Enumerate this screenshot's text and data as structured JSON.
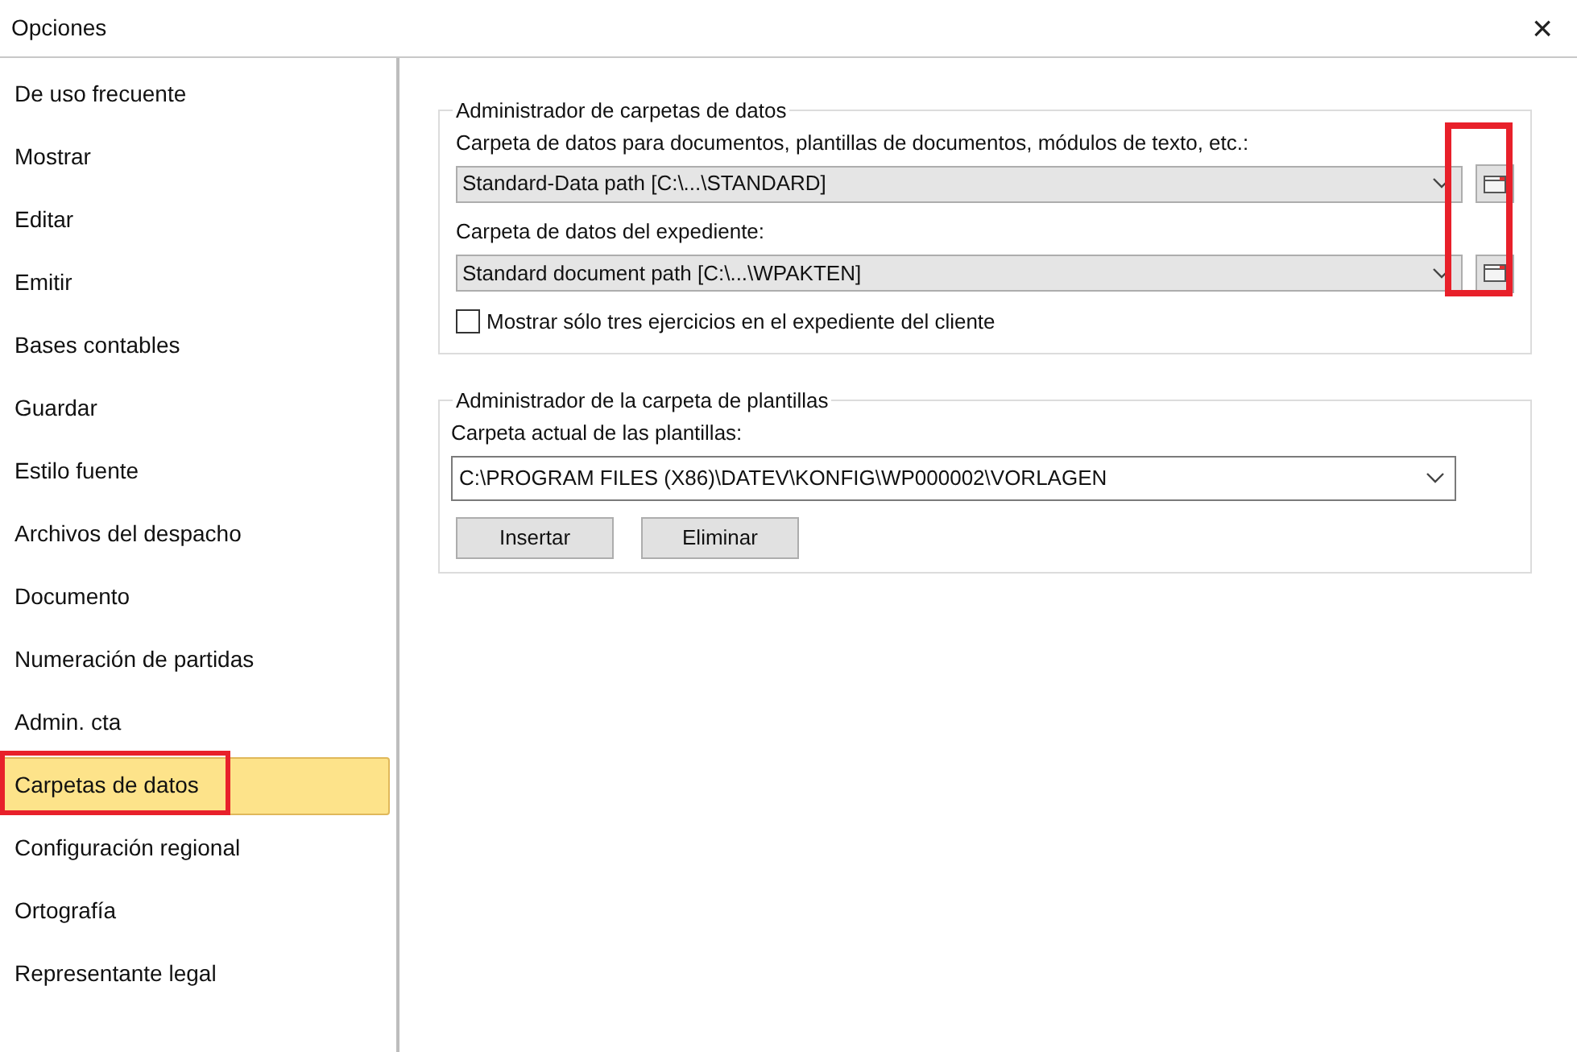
{
  "window": {
    "title": "Opciones",
    "close": "×"
  },
  "sidebar": {
    "items": [
      {
        "label": "De uso frecuente",
        "selected": false
      },
      {
        "label": "Mostrar",
        "selected": false
      },
      {
        "label": "Editar",
        "selected": false
      },
      {
        "label": "Emitir",
        "selected": false
      },
      {
        "label": "Bases contables",
        "selected": false
      },
      {
        "label": "Guardar",
        "selected": false
      },
      {
        "label": "Estilo fuente",
        "selected": false
      },
      {
        "label": "Archivos del despacho",
        "selected": false
      },
      {
        "label": "Documento",
        "selected": false
      },
      {
        "label": "Numeración de partidas",
        "selected": false
      },
      {
        "label": "Admin. cta",
        "selected": false
      },
      {
        "label": "Carpetas de datos",
        "selected": true
      },
      {
        "label": "Configuración regional",
        "selected": false
      },
      {
        "label": "Ortografía",
        "selected": false
      },
      {
        "label": "Representante legal",
        "selected": false
      }
    ]
  },
  "data_folders": {
    "title": "Administrador de carpetas de datos",
    "fields": [
      {
        "label": "Carpeta de datos para documentos, plantillas de documentos, módulos de texto, etc.:",
        "value": "Standard-Data path [C:\\...\\STANDARD]"
      },
      {
        "label": "Carpeta de datos del expediente:",
        "value": "Standard document path [C:\\...\\WPAKTEN]"
      }
    ],
    "checkbox": {
      "label": "Mostrar sólo tres ejercicios en el expediente del cliente",
      "checked": false
    }
  },
  "template_folders": {
    "title": "Administrador de la carpeta de plantillas",
    "label": "Carpeta actual de las plantillas:",
    "value": "C:\\PROGRAM FILES (X86)\\DATEV\\KONFIG\\WP000002\\VORLAGEN",
    "buttons": [
      "Insertar",
      "Eliminar"
    ]
  }
}
